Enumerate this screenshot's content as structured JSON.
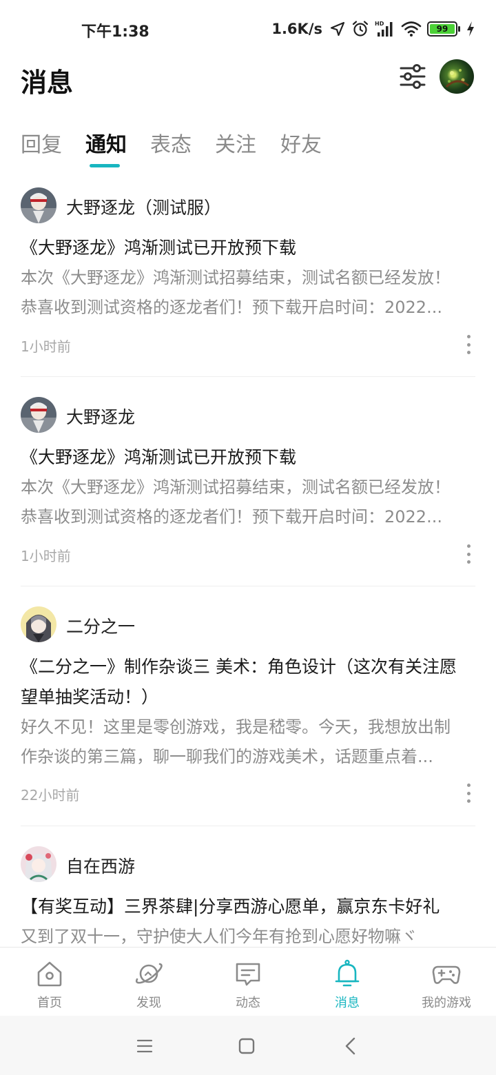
{
  "status_bar": {
    "time": "下午1:38",
    "network_speed": "1.6K/s",
    "battery": "99",
    "icons": [
      "location-arrow-icon",
      "alarm-icon",
      "hd-signal-icon",
      "wifi-icon",
      "battery-icon",
      "charging-icon"
    ]
  },
  "header": {
    "title": "消息",
    "filter_icon": "filter-sliders-icon",
    "avatar": "user-avatar"
  },
  "tabs": [
    {
      "label": "回复"
    },
    {
      "label": "通知"
    },
    {
      "label": "表态"
    },
    {
      "label": "关注"
    },
    {
      "label": "好友"
    }
  ],
  "active_tab": "通知",
  "accent_color": "#18b6c0",
  "notifications": [
    {
      "name": "大野逐龙（测试服）",
      "title": "《大野逐龙》鸿渐测试已开放预下载",
      "body_line1": "本次《大野逐龙》鸿渐测试招募结束，测试名额已经发放！",
      "body_line2": "恭喜收到测试资格的逐龙者们！预下载开启时间：2022...",
      "time": "1小时前"
    },
    {
      "name": "大野逐龙",
      "title": "《大野逐龙》鸿渐测试已开放预下载",
      "body_line1": "本次《大野逐龙》鸿渐测试招募结束，测试名额已经发放！",
      "body_line2": "恭喜收到测试资格的逐龙者们！预下载开启时间：2022...",
      "time": "1小时前"
    },
    {
      "name": "二分之一",
      "title_line1": "《二分之一》制作杂谈三  美术：角色设计（这次有关注愿",
      "title_line2": "望单抽奖活动！）",
      "body_line1": "好久不见！这里是零创游戏，我是嵇零。今天，我想放出制",
      "body_line2": "作杂谈的第三篇，聊一聊我们的游戏美术，话题重点着...",
      "time": "22小时前"
    },
    {
      "name": "自在西游",
      "title": "【有奖互动】三界茶肆|分享西游心愿单，赢京东卡好礼",
      "body_line1": "又到了双十一，守护使大人们今年有抢到心愿好物嘛ヾ"
    }
  ],
  "bottom_nav": [
    {
      "label": "首页",
      "icon": "home-icon"
    },
    {
      "label": "发现",
      "icon": "discover-planet-icon"
    },
    {
      "label": "动态",
      "icon": "feed-chat-icon"
    },
    {
      "label": "消息",
      "icon": "bell-icon"
    },
    {
      "label": "我的游戏",
      "icon": "gamepad-icon"
    }
  ],
  "system_nav": [
    "menu-icon",
    "home-square-icon",
    "back-icon"
  ]
}
